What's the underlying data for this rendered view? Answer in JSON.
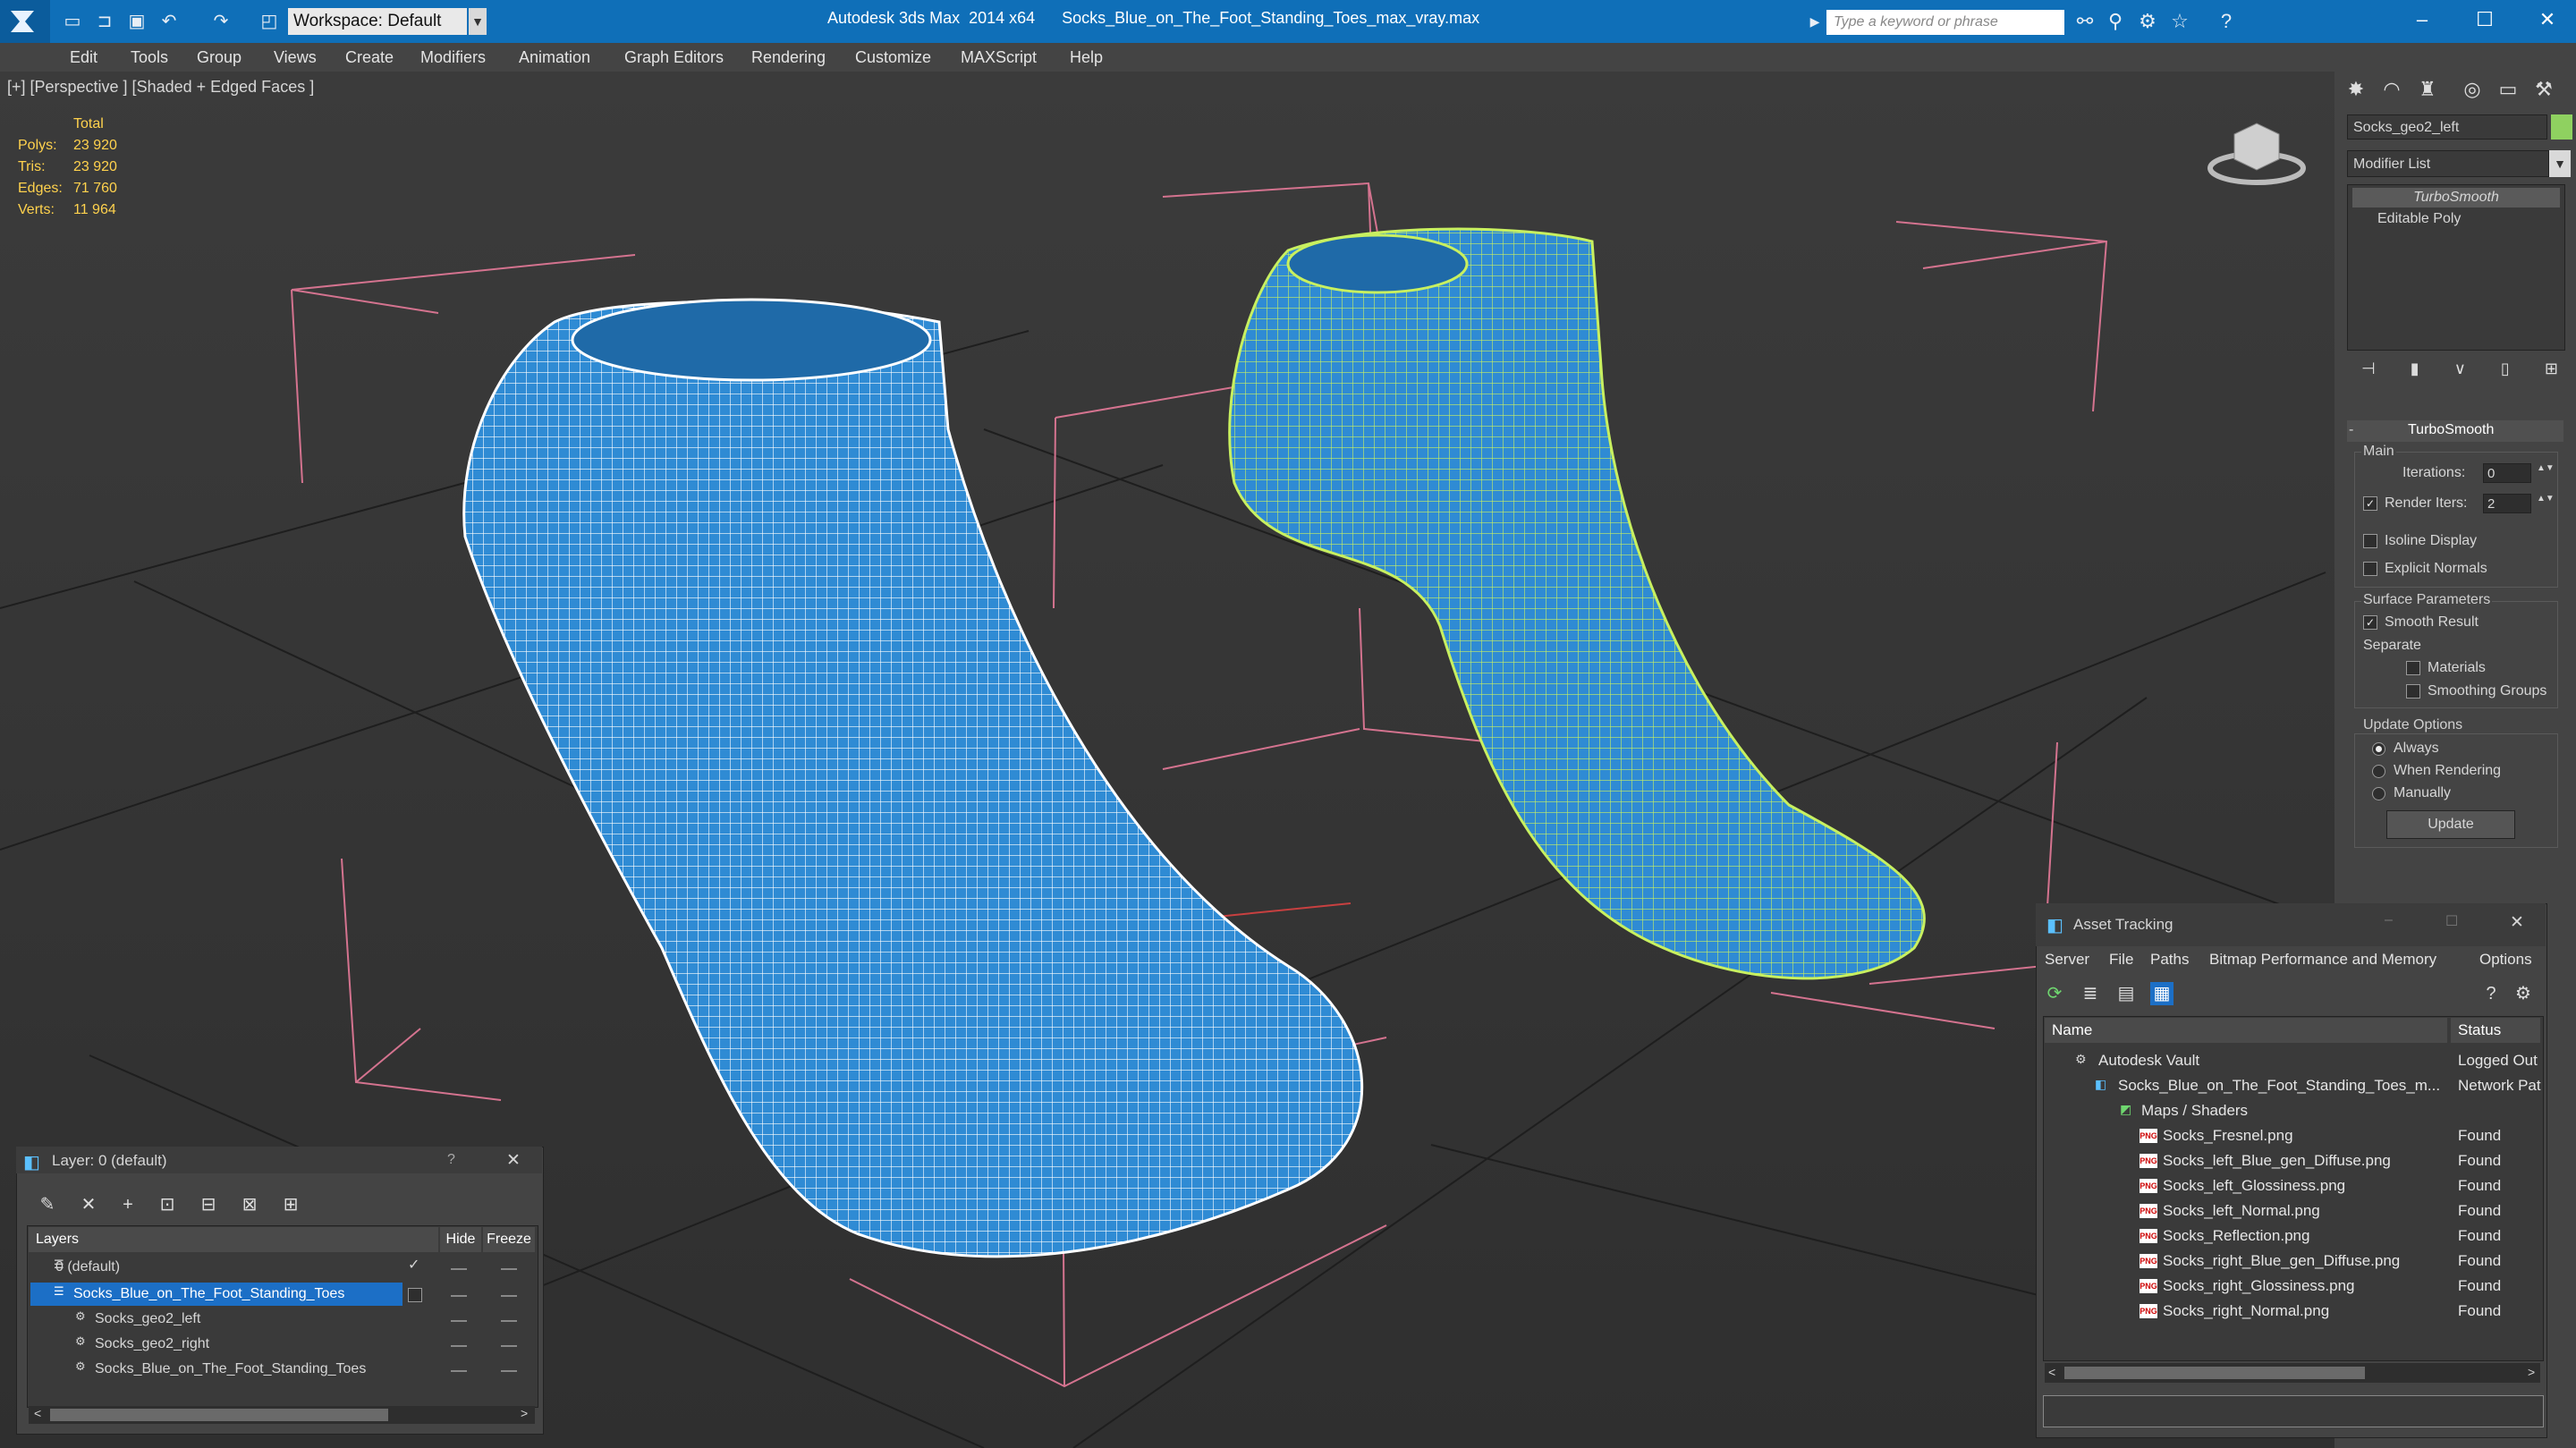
{
  "titlebar": {
    "title": "Autodesk 3ds Max  2014 x64      Socks_Blue_on_The_Foot_Standing_Toes_max_vray.max",
    "workspace": "Workspace: Default",
    "search_placeholder": "Type a keyword or phrase",
    "accent": "#0f6fb8"
  },
  "menu": [
    "Edit",
    "Tools",
    "Group",
    "Views",
    "Create",
    "Modifiers",
    "Animation",
    "Graph Editors",
    "Rendering",
    "Customize",
    "MAXScript",
    "Help"
  ],
  "viewport": {
    "label": "[+] [Perspective ] [Shaded + Edged Faces ]",
    "stats_header": "Total",
    "stats": [
      {
        "label": "Polys:",
        "value": "23 920"
      },
      {
        "label": "Tris:",
        "value": "23 920"
      },
      {
        "label": "Edges:",
        "value": "71 760"
      },
      {
        "label": "Verts:",
        "value": "11 964"
      }
    ],
    "sock_color": "#2f8bd4",
    "wire_selected_color": "#c8f060"
  },
  "command_panel": {
    "object_name": "Socks_geo2_left",
    "object_color": "#8fd160",
    "modifier_list": "Modifier List",
    "stack": [
      "TurboSmooth",
      "Editable Poly"
    ],
    "rollout_title": "TurboSmooth",
    "main_label": "Main",
    "iterations_label": "Iterations:",
    "iterations_value": "0",
    "render_iters_label": "Render Iters:",
    "render_iters_value": "2",
    "render_iters_checked": true,
    "isoline_label": "Isoline Display",
    "explicit_label": "Explicit Normals",
    "surface_label": "Surface Parameters",
    "smooth_result_label": "Smooth Result",
    "separate_label": "Separate",
    "materials_label": "Materials",
    "smoothing_groups_label": "Smoothing Groups",
    "update_options_label": "Update Options",
    "update_options": [
      "Always",
      "When Rendering",
      "Manually"
    ],
    "update_selected": "Always",
    "update_button": "Update"
  },
  "layer_dialog": {
    "title": "Layer: 0 (default)",
    "help": "?",
    "col_layers": "Layers",
    "col_hide": "Hide",
    "col_freeze": "Freeze",
    "rows": [
      {
        "name": "0 (default)",
        "indent": 0
      },
      {
        "name": "Socks_Blue_on_The_Foot_Standing_Toes",
        "indent": 0,
        "selected": true
      },
      {
        "name": "Socks_geo2_left",
        "indent": 1
      },
      {
        "name": "Socks_geo2_right",
        "indent": 1
      },
      {
        "name": "Socks_Blue_on_The_Foot_Standing_Toes",
        "indent": 1
      }
    ]
  },
  "asset_dialog": {
    "title": "Asset Tracking",
    "menu": [
      "Server",
      "File",
      "Paths",
      "Bitmap Performance and Memory",
      "Options"
    ],
    "col_name": "Name",
    "col_status": "Status",
    "rows": [
      {
        "name": "Autodesk Vault",
        "status": "Logged Out",
        "indent": 0,
        "icon": "vault"
      },
      {
        "name": "Socks_Blue_on_The_Foot_Standing_Toes_m...",
        "status": "Network Pat",
        "indent": 1,
        "icon": "max"
      },
      {
        "name": "Maps / Shaders",
        "status": "",
        "indent": 2,
        "icon": "maps"
      },
      {
        "name": "Socks_Fresnel.png",
        "status": "Found",
        "indent": 3,
        "icon": "png"
      },
      {
        "name": "Socks_left_Blue_gen_Diffuse.png",
        "status": "Found",
        "indent": 3,
        "icon": "png"
      },
      {
        "name": "Socks_left_Glossiness.png",
        "status": "Found",
        "indent": 3,
        "icon": "png"
      },
      {
        "name": "Socks_left_Normal.png",
        "status": "Found",
        "indent": 3,
        "icon": "png"
      },
      {
        "name": "Socks_Reflection.png",
        "status": "Found",
        "indent": 3,
        "icon": "png"
      },
      {
        "name": "Socks_right_Blue_gen_Diffuse.png",
        "status": "Found",
        "indent": 3,
        "icon": "png"
      },
      {
        "name": "Socks_right_Glossiness.png",
        "status": "Found",
        "indent": 3,
        "icon": "png"
      },
      {
        "name": "Socks_right_Normal.png",
        "status": "Found",
        "indent": 3,
        "icon": "png"
      }
    ]
  }
}
